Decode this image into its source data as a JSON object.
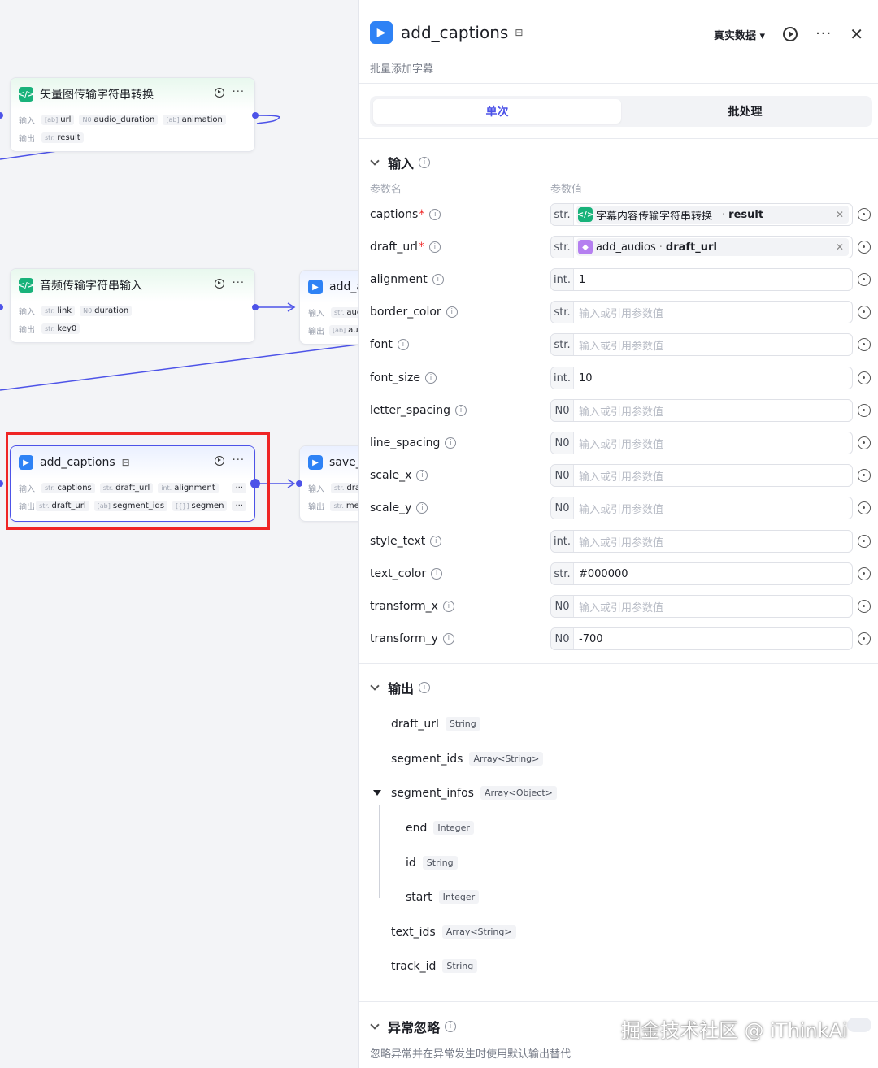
{
  "canvas": {
    "nodes": [
      {
        "title": "矢量图传输字符串转换",
        "icon": "code-icon",
        "input_label": "输入",
        "output_label": "输出",
        "inputs": [
          {
            "type": "[ab]",
            "name": "url"
          },
          {
            "type": "N0",
            "name": "audio_duration"
          },
          {
            "type": "[ab]",
            "name": "animation"
          }
        ],
        "outputs": [
          {
            "type": "str.",
            "name": "result"
          }
        ]
      },
      {
        "title": "音频传输字符串输入",
        "icon": "code-icon",
        "input_label": "输入",
        "output_label": "输出",
        "inputs": [
          {
            "type": "str.",
            "name": "link"
          },
          {
            "type": "N0",
            "name": "duration"
          }
        ],
        "outputs": [
          {
            "type": "str.",
            "name": "key0"
          }
        ]
      },
      {
        "title": "add_captions",
        "icon": "play-icon",
        "input_label": "输入",
        "output_label": "输出",
        "inputs": [
          {
            "type": "str.",
            "name": "captions"
          },
          {
            "type": "str.",
            "name": "draft_url"
          },
          {
            "type": "int.",
            "name": "alignment"
          }
        ],
        "outputs": [
          {
            "type": "str.",
            "name": "draft_url"
          },
          {
            "type": "[ab]",
            "name": "segment_ids"
          },
          {
            "type": "[{}]",
            "name": "segmen"
          }
        ]
      },
      {
        "title": "add_a",
        "icon": "play-icon",
        "input_label": "输入",
        "output_label": "输出",
        "inputs": [
          {
            "type": "str.",
            "name": "aud"
          }
        ],
        "outputs": [
          {
            "type": "[ab]",
            "name": "aud"
          }
        ]
      },
      {
        "title": "save_",
        "icon": "play-icon",
        "input_label": "输入",
        "output_label": "输出",
        "inputs": [
          {
            "type": "str.",
            "name": "draf"
          }
        ],
        "outputs": [
          {
            "type": "str.",
            "name": "mes"
          }
        ]
      }
    ]
  },
  "panel": {
    "title": "add_captions",
    "subtitle": "批量添加字幕",
    "mode": "真实数据 ▾",
    "tabs": [
      "单次",
      "批处理"
    ],
    "input_section": "输入",
    "col_name": "参数名",
    "col_value": "参数值",
    "params": [
      {
        "name": "captions",
        "required": "*",
        "type": "str.",
        "ref_source": "字幕内容传输字符串转换",
        "ref_field": "result",
        "ref_icon": "code-icon"
      },
      {
        "name": "draft_url",
        "required": "*",
        "type": "str.",
        "ref_source": "add_audios",
        "ref_field": "draft_url",
        "ref_icon": "cube-icon"
      },
      {
        "name": "alignment",
        "type": "int.",
        "value": "1"
      },
      {
        "name": "border_color",
        "type": "str.",
        "placeholder": "输入或引用参数值"
      },
      {
        "name": "font",
        "type": "str.",
        "placeholder": "输入或引用参数值"
      },
      {
        "name": "font_size",
        "type": "int.",
        "value": "10"
      },
      {
        "name": "letter_spacing",
        "type": "N0",
        "placeholder": "输入或引用参数值"
      },
      {
        "name": "line_spacing",
        "type": "N0",
        "placeholder": "输入或引用参数值"
      },
      {
        "name": "scale_x",
        "type": "N0",
        "placeholder": "输入或引用参数值"
      },
      {
        "name": "scale_y",
        "type": "N0",
        "placeholder": "输入或引用参数值"
      },
      {
        "name": "style_text",
        "type": "int.",
        "placeholder": "输入或引用参数值"
      },
      {
        "name": "text_color",
        "type": "str.",
        "value": "#000000"
      },
      {
        "name": "transform_x",
        "type": "N0",
        "placeholder": "输入或引用参数值"
      },
      {
        "name": "transform_y",
        "type": "N0",
        "value": "-700"
      }
    ],
    "output_section": "输出",
    "outputs": [
      {
        "name": "draft_url",
        "type": "String"
      },
      {
        "name": "segment_ids",
        "type": "Array<String>"
      },
      {
        "name": "segment_infos",
        "type": "Array<Object>"
      },
      {
        "name": "end",
        "type": "Integer"
      },
      {
        "name": "id",
        "type": "String"
      },
      {
        "name": "start",
        "type": "Integer"
      },
      {
        "name": "text_ids",
        "type": "Array<String>"
      },
      {
        "name": "track_id",
        "type": "String"
      }
    ],
    "exception_section": "异常忽略",
    "exception_desc": "忽略异常并在异常发生时使用默认输出替代"
  },
  "watermark": "掘金技术社区 @ iThinkAi",
  "colors": {
    "accent": "#4d53e8",
    "selection": "#ef2525",
    "code_icon": "#18b27a",
    "play_icon": "#2e82f5"
  }
}
